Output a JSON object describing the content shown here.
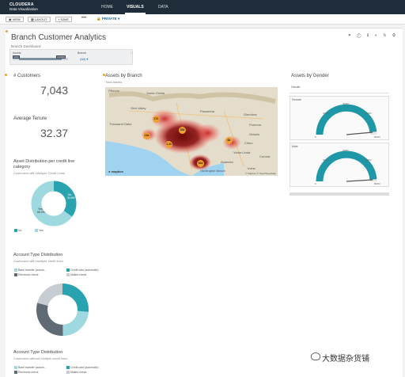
{
  "nav": {
    "brand_line1": "CLOUDERA",
    "brand_line2": "Data Visualization",
    "tabs": [
      {
        "label": "HOME"
      },
      {
        "label": "VISUALS"
      },
      {
        "label": "DATA"
      }
    ]
  },
  "toolbar": {
    "view_label": "VIEW",
    "layout_label": "LAYOUT",
    "save_label": "SAVE",
    "more_label": "•••",
    "privacy_label": "PRIVATE"
  },
  "dashboard": {
    "title": "Branch Customer Analytics",
    "subtitle": "Branch Dashboard",
    "filters": {
      "assets_label": "Assets",
      "assets_min": "1000",
      "assets_max": "100000",
      "branch_label": "Branch",
      "branch_value": "(All)"
    }
  },
  "customers": {
    "title": "# Customers",
    "value": "7,043"
  },
  "tenure": {
    "title": "Average Tenure",
    "value": "32.37"
  },
  "asset_dist": {
    "title_line1": "Asset Distribution per credit line",
    "title_line2": "category",
    "subtitle": "Customers with Multiple Credit Lines",
    "legend": [
      "No",
      "Yes"
    ],
    "label_no": "No",
    "pct_no": "34.8%",
    "label_yes": "Yes",
    "pct_yes": "65.2%",
    "colors": {
      "no": "#2aa3b0",
      "yes": "#9dd9df"
    }
  },
  "account_type_1": {
    "title": "Account Type Distribution",
    "subtitle": "Customers with multiple credit lines",
    "legend": [
      "Bank transfer (autom...",
      "Credit card (automatic)",
      "Electronic check",
      "Mailed check"
    ]
  },
  "account_type_2": {
    "title": "Account Type Distribution",
    "subtitle": "Customers without multiple credit lines",
    "legend": [
      "Bank transfer (autom...",
      "Credit card (automatic)",
      "Electronic check",
      "Mailed check"
    ]
  },
  "map": {
    "title": "Assets by Branch",
    "subtitle": "Total Assets",
    "places": [
      "Fillmore",
      "Santa Clarita",
      "Simi Valley",
      "Thousand Oaks",
      "Pasadena",
      "Glendora",
      "Ontario",
      "Chino",
      "Yorba Linda",
      "Corona",
      "Anaheim",
      "Irvine",
      "Huntington Beach",
      "Pomona"
    ],
    "badges": [
      "17k",
      "33k",
      "13k",
      "1.2k",
      "6k",
      "64k"
    ],
    "logo": "mapbox",
    "attribution": "© Mapbox © OpenStreetMap"
  },
  "gender": {
    "title": "Assets by Gender",
    "header": "Gender",
    "rows": [
      {
        "label": "Female",
        "ticks": {
          "t0": "0",
          "t200": "200M",
          "t400": "400M",
          "t600": "600M",
          "t800": "800M"
        },
        "level": 0.97
      },
      {
        "label": "Male",
        "ticks": {
          "t0": "0",
          "t200": "200M",
          "t400": "400M",
          "t600": "600M",
          "t800": "800M"
        },
        "level": 0.98
      }
    ],
    "gauge_color": "#1e97a6"
  },
  "watermark": "大数据杂货铺"
}
